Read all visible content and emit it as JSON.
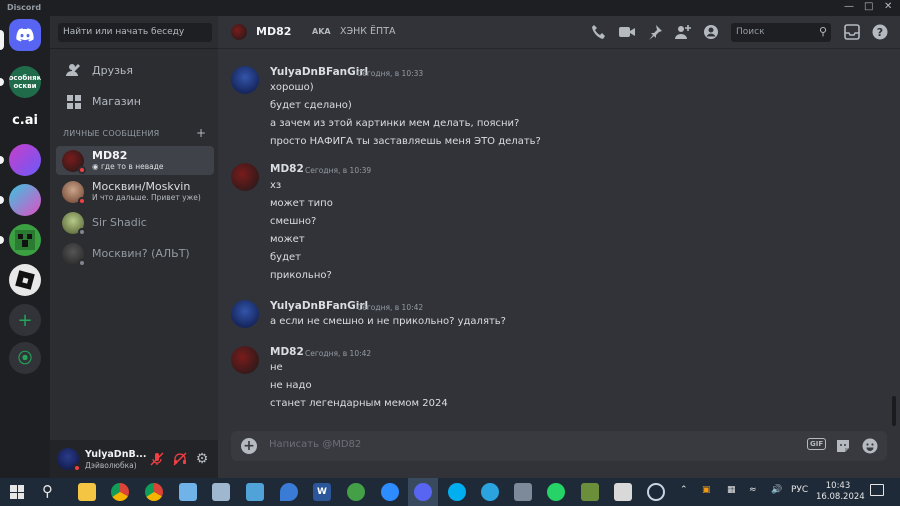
{
  "titlebar": {
    "app_name": "Discord"
  },
  "servers": [
    {
      "name": "home",
      "label": ""
    },
    {
      "name": "osobnyak",
      "label": "особняк\nоскви"
    },
    {
      "name": "cai",
      "label": "c.ai"
    },
    {
      "name": "server-4",
      "label": ""
    },
    {
      "name": "server-5",
      "label": ""
    },
    {
      "name": "minecraft",
      "label": ""
    },
    {
      "name": "roblox",
      "label": ""
    }
  ],
  "sidebar": {
    "search_placeholder": "Найти или начать беседу",
    "friends_label": "Друзья",
    "shop_label": "Магазин",
    "dm_header": "ЛИЧНЫЕ СООБЩЕНИЯ",
    "dms": [
      {
        "name": "MD82",
        "status": "где то в неваде",
        "active": true,
        "status_color": "#f23f43"
      },
      {
        "name": "Москвин/Moskvin",
        "status": "И что дальше. Привет уже)",
        "active": false,
        "status_color": "#f23f43"
      },
      {
        "name": "Sir Shadic",
        "status": "",
        "active": false,
        "status_color": "#80848e"
      },
      {
        "name": "Москвин? (АЛЬТ)",
        "status": "",
        "active": false,
        "status_color": "#80848e"
      }
    ]
  },
  "user_panel": {
    "username": "YulyaDnB...",
    "status": "Дэйволюбка)"
  },
  "header": {
    "name": "MD82",
    "tag": "AKA",
    "nickname": "ХЭНК ЁПТА",
    "search_placeholder": "Поиск"
  },
  "messages": [
    {
      "author": "YulyaDnBFanGirl",
      "time": "Сегодня, в 10:33",
      "author_color": "#f2f3f5",
      "lines": [
        "хорошо)",
        "будет сделано)",
        "а зачем из этой картинки мем делать, поясни?",
        "просто НАФИГА ты заставляешь меня ЭТО делать?"
      ]
    },
    {
      "author": "MD82",
      "time": "Сегодня, в 10:39",
      "author_color": "#f2f3f5",
      "lines": [
        "хз",
        "может типо",
        "смешно?",
        "может",
        "будет",
        "прикольно?"
      ]
    },
    {
      "author": "YulyaDnBFanGirl",
      "time": "Сегодня, в 10:42",
      "author_color": "#f2f3f5",
      "lines": [
        "а если не смешно и не прикольно? удалять?"
      ]
    },
    {
      "author": "MD82",
      "time": "Сегодня, в 10:42",
      "author_color": "#f2f3f5",
      "lines": [
        "не",
        "не надо",
        "станет легендарным мемом 2024"
      ]
    }
  ],
  "composer": {
    "placeholder": "Написать @MD82",
    "gif_label": "GIF"
  },
  "taskbar": {
    "lang": "РУС",
    "time": "10:43",
    "date": "16.08.2024"
  }
}
